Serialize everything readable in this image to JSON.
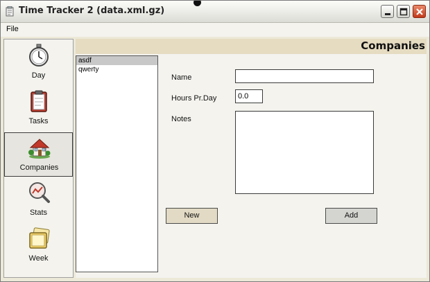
{
  "window": {
    "title": "Time Tracker 2 (data.xml.gz)"
  },
  "menu": {
    "file": "File"
  },
  "sidebar": {
    "items": [
      {
        "label": "Day",
        "icon": "stopwatch-icon",
        "selected": false
      },
      {
        "label": "Tasks",
        "icon": "clipboard-icon",
        "selected": false
      },
      {
        "label": "Companies",
        "icon": "house-icon",
        "selected": true
      },
      {
        "label": "Stats",
        "icon": "magnifier-chart-icon",
        "selected": false
      },
      {
        "label": "Week",
        "icon": "calendar-stack-icon",
        "selected": false
      }
    ]
  },
  "content": {
    "title": "Companies",
    "companies": [
      "asdf",
      "qwerty"
    ],
    "selected_company": "asdf",
    "form": {
      "name_label": "Name",
      "name_value": "",
      "hours_label": "Hours Pr.Day",
      "hours_value": "0.0",
      "notes_label": "Notes",
      "notes_value": ""
    },
    "buttons": {
      "new": "New",
      "add": "Add"
    }
  },
  "colors": {
    "header_band": "#e6dcc2",
    "new_button": "#e2dac4",
    "close_button": "#c2391b"
  }
}
